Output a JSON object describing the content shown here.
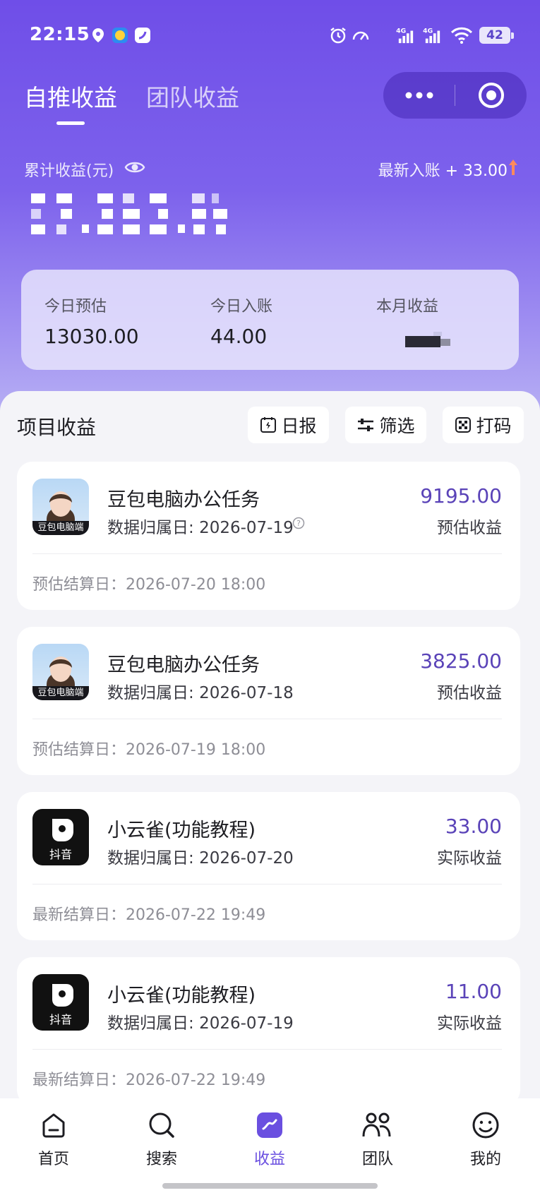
{
  "status_bar": {
    "time": "22:15",
    "battery": "42"
  },
  "header": {
    "tabs": [
      {
        "label": "自推收益",
        "active": true
      },
      {
        "label": "团队收益",
        "active": false
      }
    ]
  },
  "earnings": {
    "cumulative_label": "累计收益(元)",
    "latest_label": "最新入账",
    "latest_amount": "+ 33.00",
    "stats": [
      {
        "label": "今日预估",
        "value": "13030.00"
      },
      {
        "label": "今日入账",
        "value": "44.00"
      },
      {
        "label": "本月收益",
        "value": ""
      }
    ]
  },
  "section": {
    "title": "项目收益",
    "buttons": {
      "daily": "日报",
      "filter": "筛选",
      "code": "打码"
    }
  },
  "items": [
    {
      "name": "豆包电脑办公任务",
      "date_label": "数据归属日:",
      "date": "2026-07-19",
      "amount": "9195.00",
      "amount_type": "预估收益",
      "settle": "预估结算日：2026-07-20 18:00",
      "logo_badge": "豆包电脑端"
    },
    {
      "name": "豆包电脑办公任务",
      "date_label": "数据归属日:",
      "date": "2026-07-18",
      "amount": "3825.00",
      "amount_type": "预估收益",
      "settle": "预估结算日：2026-07-19 18:00",
      "logo_badge": "豆包电脑端"
    },
    {
      "name": "小云雀(功能教程)",
      "date_label": "数据归属日:",
      "date": "2026-07-20",
      "amount": "33.00",
      "amount_type": "实际收益",
      "settle": "最新结算日：2026-07-22 19:49",
      "logo_badge": "抖音"
    },
    {
      "name": "小云雀(功能教程)",
      "date_label": "数据归属日:",
      "date": "2026-07-19",
      "amount": "11.00",
      "amount_type": "实际收益",
      "settle": "最新结算日：2026-07-22 19:49",
      "logo_badge": "抖音"
    }
  ],
  "nav": [
    {
      "label": "首页",
      "icon": "home-icon"
    },
    {
      "label": "搜索",
      "icon": "search-icon"
    },
    {
      "label": "收益",
      "icon": "earnings-icon",
      "active": true
    },
    {
      "label": "团队",
      "icon": "team-icon"
    },
    {
      "label": "我的",
      "icon": "profile-icon"
    }
  ],
  "colors": {
    "primary": "#6f4ee8",
    "accent_amount": "#5a43b8",
    "nav_active": "#6a4fe0"
  }
}
